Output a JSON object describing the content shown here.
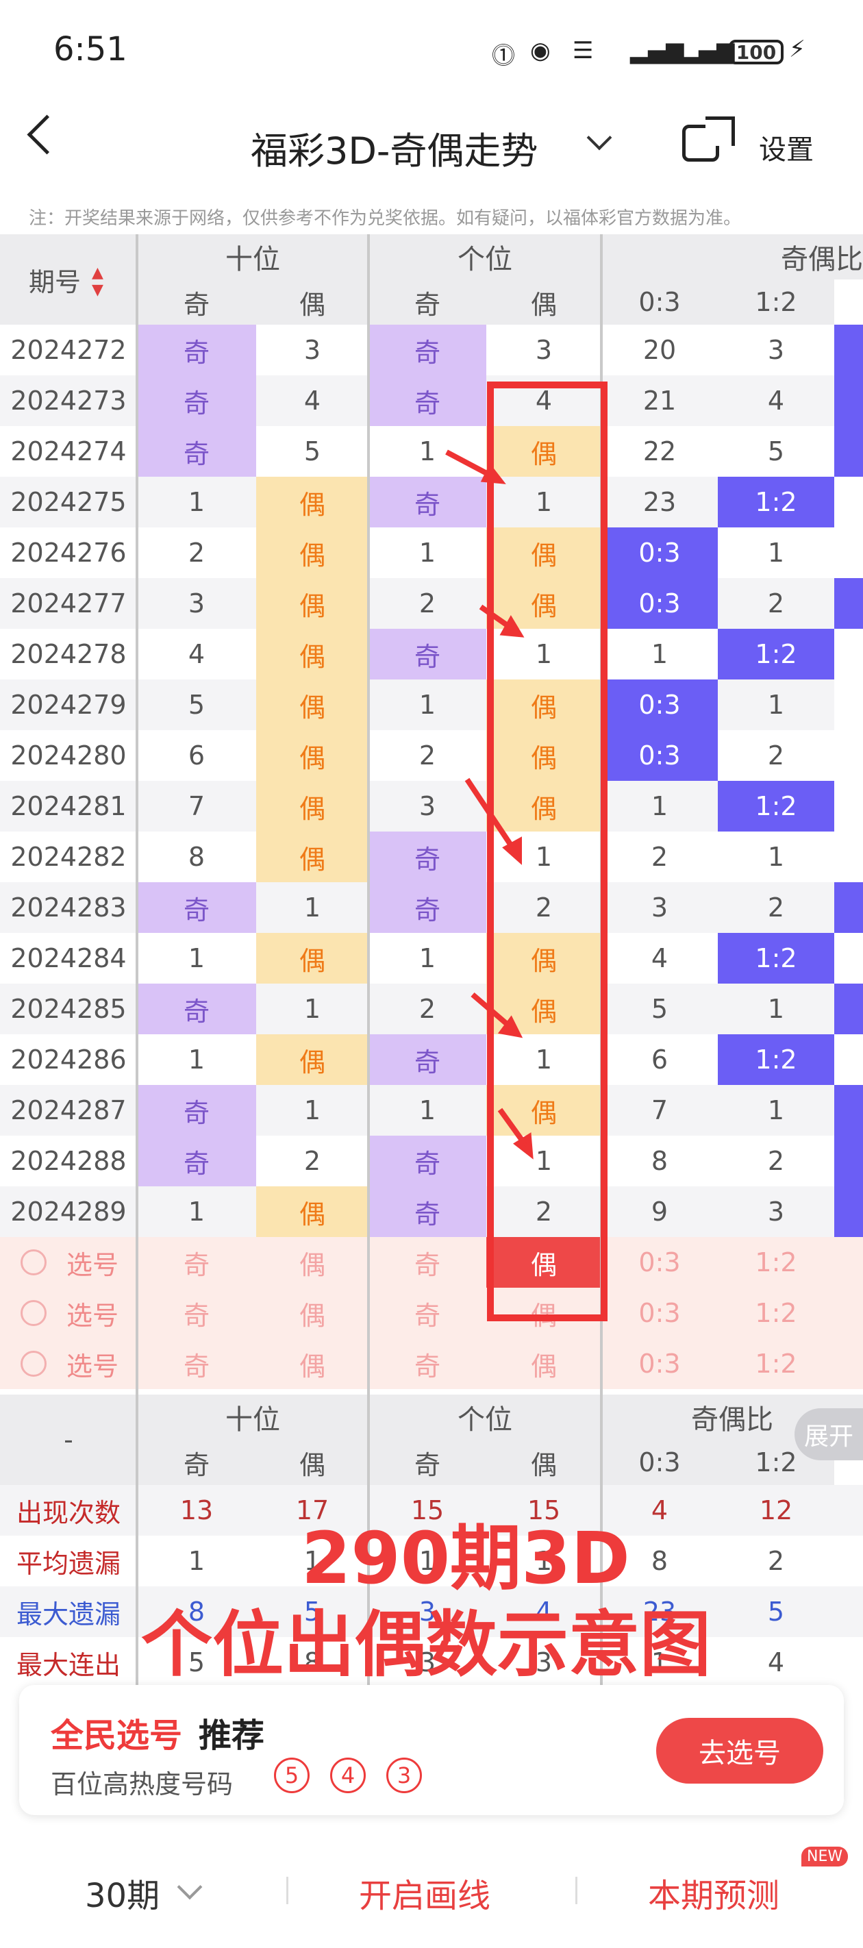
{
  "status": {
    "time": "6:51",
    "battery": "100"
  },
  "nav": {
    "title": "福彩3D-奇偶走势",
    "settings": "设置"
  },
  "notice": "注：开奖结果来源于网络，仅供参考不作为兑奖依据。如有疑问，以福体彩官方数据为准。",
  "table": {
    "issue_header": "期号",
    "groups": [
      "十位",
      "个位",
      "奇偶比"
    ],
    "sub": [
      "奇",
      "偶",
      "奇",
      "偶",
      "0:3",
      "1:2"
    ],
    "rows": [
      {
        "issue": "2024272",
        "c": [
          "奇",
          "3",
          "奇",
          "3",
          "20",
          "3"
        ],
        "t": [
          "o",
          "n",
          "o",
          "n",
          "n",
          "n"
        ]
      },
      {
        "issue": "2024273",
        "c": [
          "奇",
          "4",
          "奇",
          "4",
          "21",
          "4"
        ],
        "t": [
          "o",
          "n",
          "o",
          "n",
          "n",
          "n"
        ]
      },
      {
        "issue": "2024274",
        "c": [
          "奇",
          "5",
          "1",
          "偶",
          "22",
          "5"
        ],
        "t": [
          "o",
          "n",
          "n",
          "e",
          "n",
          "n"
        ]
      },
      {
        "issue": "2024275",
        "c": [
          "1",
          "偶",
          "奇",
          "1",
          "23",
          "1:2"
        ],
        "t": [
          "n",
          "e",
          "o",
          "n",
          "n",
          "b"
        ]
      },
      {
        "issue": "2024276",
        "c": [
          "2",
          "偶",
          "1",
          "偶",
          "0:3",
          "1"
        ],
        "t": [
          "n",
          "e",
          "n",
          "e",
          "b",
          "n"
        ]
      },
      {
        "issue": "2024277",
        "c": [
          "3",
          "偶",
          "2",
          "偶",
          "0:3",
          "2"
        ],
        "t": [
          "n",
          "e",
          "n",
          "e",
          "b",
          "n"
        ]
      },
      {
        "issue": "2024278",
        "c": [
          "4",
          "偶",
          "奇",
          "1",
          "1",
          "1:2"
        ],
        "t": [
          "n",
          "e",
          "o",
          "n",
          "n",
          "b"
        ]
      },
      {
        "issue": "2024279",
        "c": [
          "5",
          "偶",
          "1",
          "偶",
          "0:3",
          "1"
        ],
        "t": [
          "n",
          "e",
          "n",
          "e",
          "b",
          "n"
        ]
      },
      {
        "issue": "2024280",
        "c": [
          "6",
          "偶",
          "2",
          "偶",
          "0:3",
          "2"
        ],
        "t": [
          "n",
          "e",
          "n",
          "e",
          "b",
          "n"
        ]
      },
      {
        "issue": "2024281",
        "c": [
          "7",
          "偶",
          "3",
          "偶",
          "1",
          "1:2"
        ],
        "t": [
          "n",
          "e",
          "n",
          "e",
          "n",
          "b"
        ]
      },
      {
        "issue": "2024282",
        "c": [
          "8",
          "偶",
          "奇",
          "1",
          "2",
          "1"
        ],
        "t": [
          "n",
          "e",
          "o",
          "n",
          "n",
          "n"
        ]
      },
      {
        "issue": "2024283",
        "c": [
          "奇",
          "1",
          "奇",
          "2",
          "3",
          "2"
        ],
        "t": [
          "o",
          "n",
          "o",
          "n",
          "n",
          "n"
        ]
      },
      {
        "issue": "2024284",
        "c": [
          "1",
          "偶",
          "1",
          "偶",
          "4",
          "1:2"
        ],
        "t": [
          "n",
          "e",
          "n",
          "e",
          "n",
          "b"
        ]
      },
      {
        "issue": "2024285",
        "c": [
          "奇",
          "1",
          "2",
          "偶",
          "5",
          "1"
        ],
        "t": [
          "o",
          "n",
          "n",
          "e",
          "n",
          "n"
        ]
      },
      {
        "issue": "2024286",
        "c": [
          "1",
          "偶",
          "奇",
          "1",
          "6",
          "1:2"
        ],
        "t": [
          "n",
          "e",
          "o",
          "n",
          "n",
          "b"
        ]
      },
      {
        "issue": "2024287",
        "c": [
          "奇",
          "1",
          "1",
          "偶",
          "7",
          "1"
        ],
        "t": [
          "o",
          "n",
          "n",
          "e",
          "n",
          "n"
        ]
      },
      {
        "issue": "2024288",
        "c": [
          "奇",
          "2",
          "奇",
          "1",
          "8",
          "2"
        ],
        "t": [
          "o",
          "n",
          "o",
          "n",
          "n",
          "n"
        ]
      },
      {
        "issue": "2024289",
        "c": [
          "1",
          "偶",
          "奇",
          "2",
          "9",
          "3"
        ],
        "t": [
          "n",
          "e",
          "o",
          "n",
          "n",
          "n"
        ]
      }
    ],
    "select_rows": [
      {
        "label": "选号",
        "c": [
          "奇",
          "偶",
          "奇",
          "偶",
          "0:3",
          "1:2"
        ],
        "red": 3
      },
      {
        "label": "选号",
        "c": [
          "奇",
          "偶",
          "奇",
          "偶",
          "0:3",
          "1:2"
        ],
        "red": -1
      },
      {
        "label": "选号",
        "c": [
          "奇",
          "偶",
          "奇",
          "偶",
          "0:3",
          "1:2"
        ],
        "red": -1
      }
    ],
    "footer_dash": "-",
    "footer_groups": [
      "十位",
      "个位",
      "奇偶比"
    ],
    "expand": "展开",
    "stats": [
      {
        "label": "出现次数",
        "v": [
          "13",
          "17",
          "15",
          "15",
          "4",
          "12"
        ]
      },
      {
        "label": "平均遗漏",
        "v": [
          "1",
          "1",
          "1",
          "1",
          "8",
          "2"
        ]
      },
      {
        "label": "最大遗漏",
        "v": [
          "8",
          "5",
          "3",
          "4",
          "23",
          "5"
        ]
      },
      {
        "label": "最大连出",
        "v": [
          "5",
          "8",
          "3",
          "3",
          "1",
          "4"
        ]
      }
    ]
  },
  "overlay": {
    "line1": "290期3D",
    "line2": "个位出偶数示意图"
  },
  "recommend": {
    "title_a": "全民选号",
    "title_b": "推荐",
    "subtitle": "百位高热度号码",
    "balls": [
      "5",
      "4",
      "3"
    ],
    "button": "去选号"
  },
  "bottom": {
    "period": "30期",
    "draw": "开启画线",
    "predict": "本期预测",
    "new": "NEW"
  },
  "colors": {
    "odd": "#d9c2f7",
    "even": "#fbe4b0",
    "ratio": "#6b5ef5",
    "accent": "#ee4848"
  }
}
